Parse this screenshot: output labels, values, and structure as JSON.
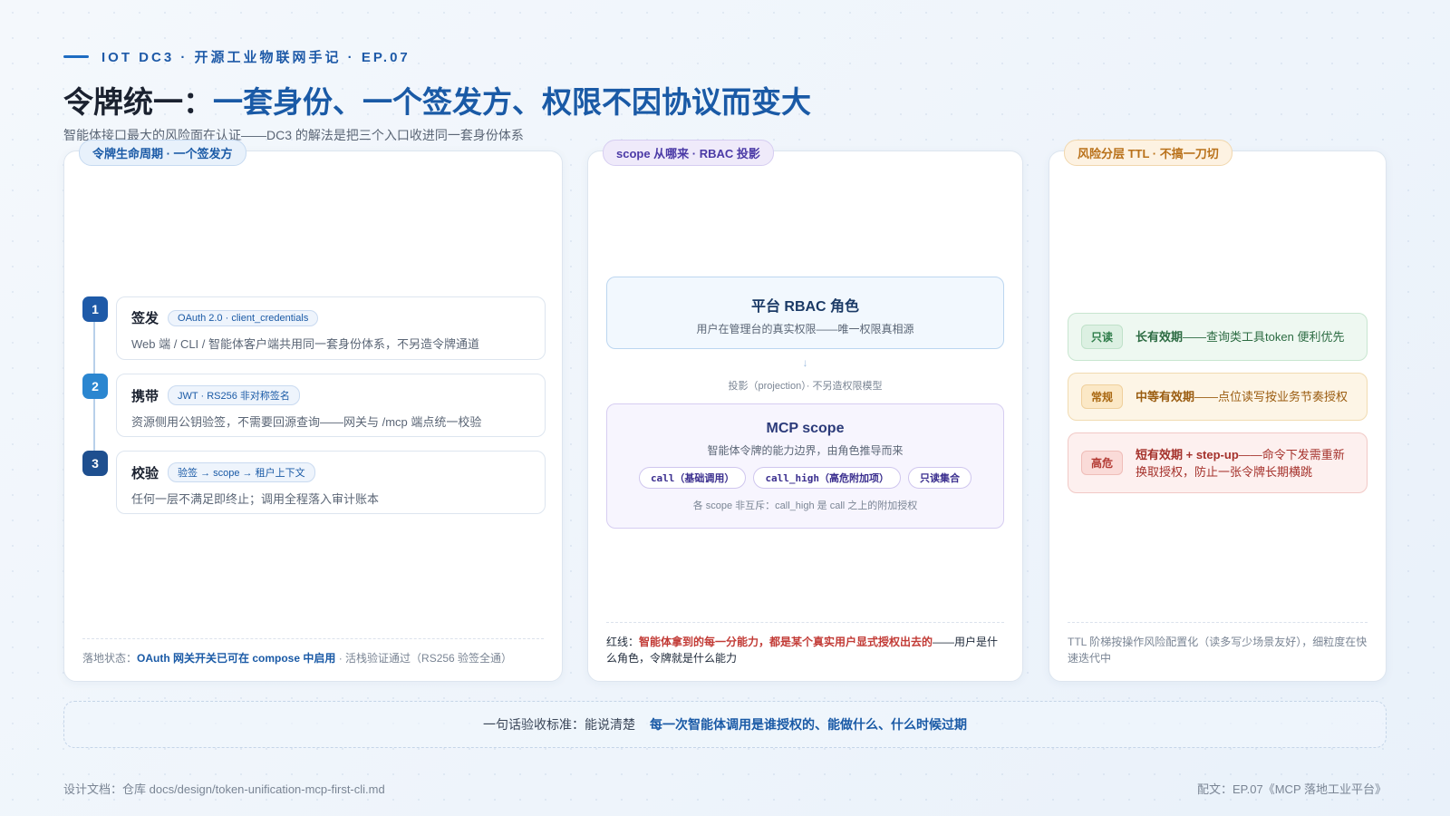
{
  "header": {
    "kicker": "IOT DC3 · 开源工业物联网手记 · EP.07",
    "title_prefix": "令牌统一：",
    "title_highlight": "一套身份、一个签发方、权限不因协议而变大",
    "subtitle": "智能体接口最大的风险面在认证——DC3 的解法是把三个入口收进同一套身份体系"
  },
  "lifecycle": {
    "tag": "令牌生命周期 · 一个签发方",
    "steps": [
      {
        "num": "1",
        "title": "签发",
        "chip": "OAuth 2.0 · client_credentials",
        "desc": "Web 端 / CLI / 智能体客户端共用同一套身份体系，不另造令牌通道"
      },
      {
        "num": "2",
        "title": "携带",
        "chip": "JWT · RS256 非对称签名",
        "desc": "资源侧用公钥验签，不需要回源查询——网关与 /mcp 端点统一校验"
      },
      {
        "num": "3",
        "title": "校验",
        "chip": "验签 → scope → 租户上下文",
        "desc": "任何一层不满足即终止；调用全程落入审计账本"
      }
    ],
    "foot_label": "落地状态：",
    "foot_strong": "OAuth 网关开关已可在 compose 中启用",
    "foot_rest": " · 活栈验证通过（RS256 验签全通）"
  },
  "scope": {
    "tag": "scope 从哪来 · RBAC 投影",
    "rbac_title": "平台 RBAC 角色",
    "rbac_desc": "用户在管理台的真实权限——唯一权限真相源",
    "arrow": "↓",
    "projection": "投影（projection）· 不另造权限模型",
    "mcp_title": "MCP scope",
    "mcp_desc": "智能体令牌的能力边界，由角色推导而来",
    "chips": [
      "call（基础调用）",
      "call_high（高危附加项）",
      "只读集合"
    ],
    "mcp_note": "各 scope 非互斥：call_high 是 call 之上的附加授权",
    "foot_label": "红线：",
    "foot_strong": "智能体拿到的每一分能力，都是某个真实用户显式授权出去的",
    "foot_rest": "——用户是什么角色，令牌就是什么能力"
  },
  "ttl": {
    "tag": "风险分层 TTL · 不搞一刀切",
    "rows": [
      {
        "badge": "只读",
        "strong": "长有效期",
        "rest": "——查询类工具token 便利优先"
      },
      {
        "badge": "常规",
        "strong": "中等有效期",
        "rest": "——点位读写按业务节奏授权"
      },
      {
        "badge": "高危",
        "strong": "短有效期 + step-up",
        "rest": "——命令下发需重新换取授权，防止一张令牌长期横跳"
      }
    ],
    "foot": "TTL 阶梯按操作风险配置化（读多写少场景友好），细粒度在快速迭代中"
  },
  "acceptance": {
    "label": "一句话验收标准：能说清楚",
    "value": "每一次智能体调用是谁授权的、能做什么、什么时候过期"
  },
  "footer": {
    "left": "设计文档：仓库 docs/design/token-unification-mcp-first-cli.md",
    "right": "配文：EP.07《MCP 落地工业平台》"
  }
}
